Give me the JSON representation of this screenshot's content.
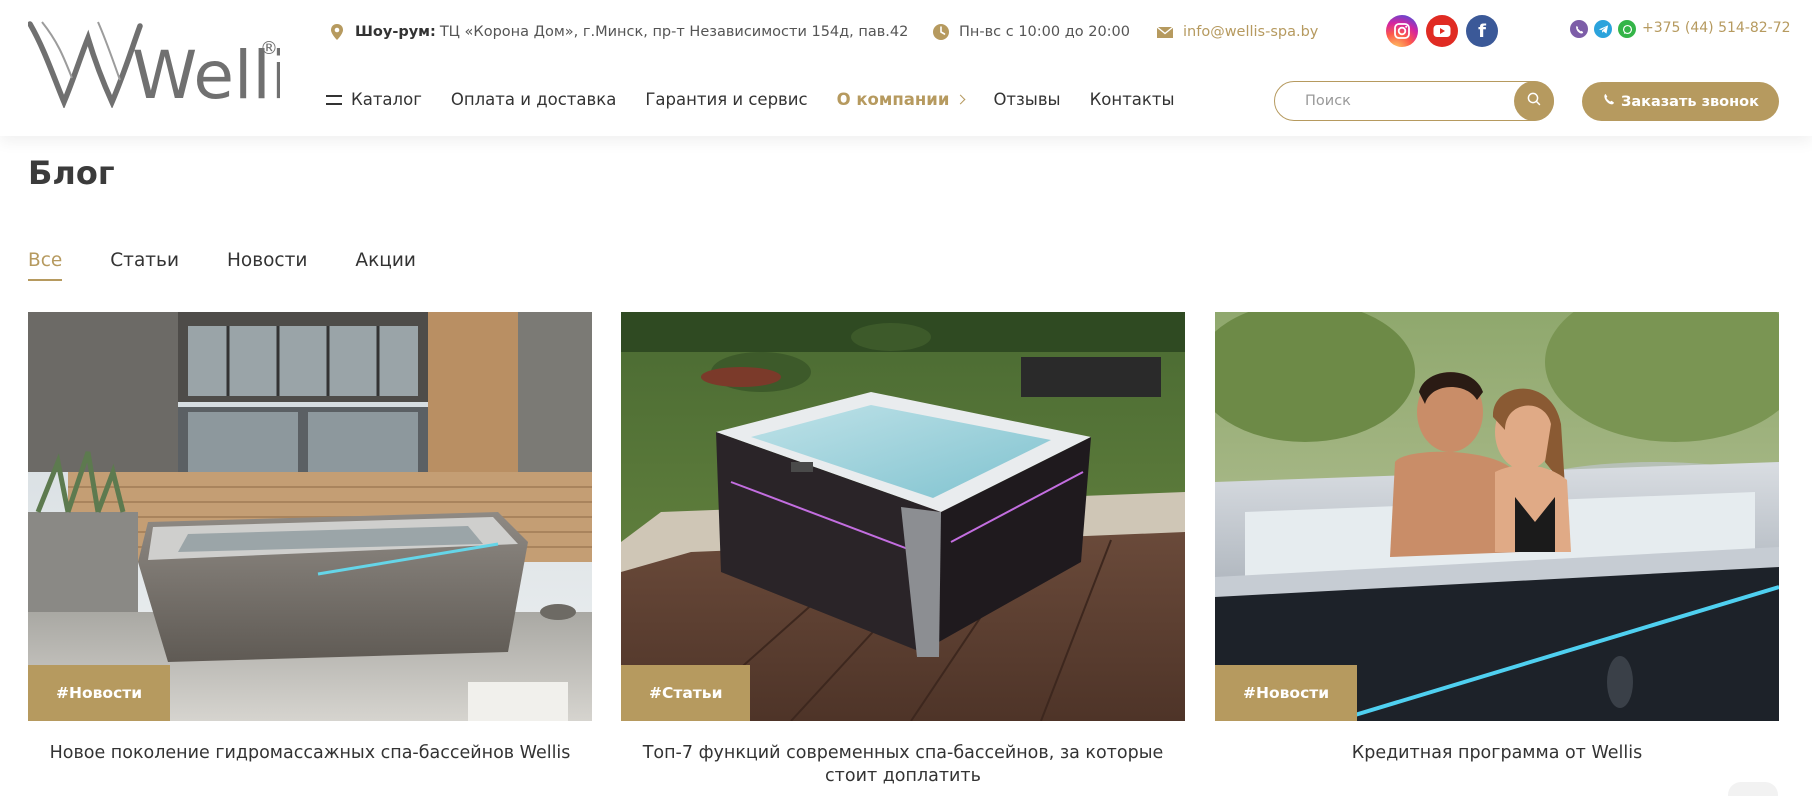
{
  "brand": {
    "logo_text": "Wellis",
    "registered": "®"
  },
  "topbar": {
    "showroom_label": "Шоу-рум:",
    "address": "ТЦ «Корона Дом», г.Минск, пр-т Независимости 154д, пав.42",
    "hours": "Пн-вс с 10:00 до 20:00",
    "email": "info@wellis-spa.by",
    "phone": "+375 (44) 514-82-72"
  },
  "social": [
    {
      "name": "instagram",
      "icon": "instagram-icon"
    },
    {
      "name": "youtube",
      "icon": "youtube-icon"
    },
    {
      "name": "facebook",
      "icon": "facebook-icon",
      "glyph": "f"
    }
  ],
  "nav": {
    "items": [
      {
        "label": "Каталог"
      },
      {
        "label": "Оплата и доставка"
      },
      {
        "label": "Гарантия и сервис"
      },
      {
        "label": "О компании"
      },
      {
        "label": "Отзывы"
      },
      {
        "label": "Контакты"
      }
    ],
    "active_index": 3
  },
  "search": {
    "placeholder": "Поиск"
  },
  "callback_button": {
    "label": "Заказать звонок"
  },
  "page": {
    "title": "Блог"
  },
  "tabs": [
    {
      "label": "Все",
      "active": true
    },
    {
      "label": "Статьи",
      "active": false
    },
    {
      "label": "Новости",
      "active": false
    },
    {
      "label": "Акции",
      "active": false
    }
  ],
  "posts": [
    {
      "tag": "#Новости",
      "title": "Новое поколение гидромассажных спа-бассейнов Wellis"
    },
    {
      "tag": "#Статьи",
      "title": "Топ-7 функций современных спа-бассейнов, за которые стоит доплатить"
    },
    {
      "tag": "#Новости",
      "title": "Кредитная программа от Wellis"
    }
  ],
  "colors": {
    "accent": "#b69a5f",
    "text": "#333333",
    "logo": "#707070"
  }
}
